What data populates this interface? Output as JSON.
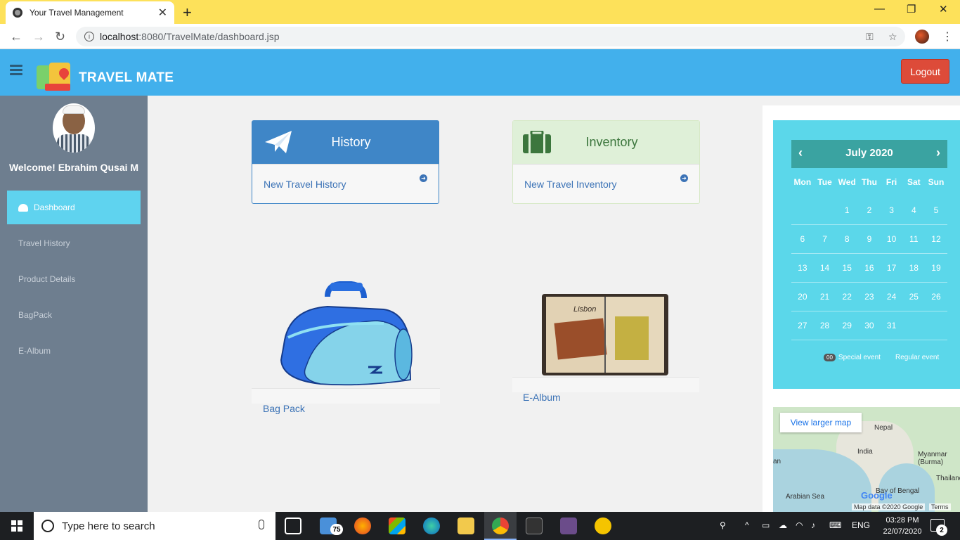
{
  "browser": {
    "tab_title": "Your Travel Management",
    "tab_close": "✕",
    "new_tab": "+",
    "url_host": "localhost",
    "url_path": ":8080/TravelMate/dashboard.jsp"
  },
  "header": {
    "brand": "TRAVEL MATE",
    "logout_label": "Logout"
  },
  "sidebar": {
    "welcome": "Welcome! Ebrahim Qusai M",
    "items": [
      {
        "label": "Dashboard",
        "active": true
      },
      {
        "label": "Travel History",
        "active": false
      },
      {
        "label": "Product Details",
        "active": false
      },
      {
        "label": "BagPack",
        "active": false
      },
      {
        "label": "E-Album",
        "active": false
      }
    ]
  },
  "cards": {
    "history": {
      "title": "History",
      "link": "New Travel History"
    },
    "inventory": {
      "title": "Inventory",
      "link": "New Travel Inventory"
    }
  },
  "gallery": {
    "bagpack_caption": "Bag Pack",
    "album_caption": "E-Album",
    "album_text": "Lisbon"
  },
  "calendar": {
    "month": "July 2020",
    "prev": "‹",
    "next": "›",
    "weekdays": [
      "Mon",
      "Tue",
      "Wed",
      "Thu",
      "Fri",
      "Sat",
      "Sun"
    ],
    "weeks": [
      [
        "",
        "",
        "1",
        "2",
        "3",
        "4",
        "5"
      ],
      [
        "6",
        "7",
        "8",
        "9",
        "10",
        "11",
        "12"
      ],
      [
        "13",
        "14",
        "15",
        "16",
        "17",
        "18",
        "19"
      ],
      [
        "20",
        "21",
        "22",
        "23",
        "24",
        "25",
        "26"
      ],
      [
        "27",
        "28",
        "29",
        "30",
        "31",
        "",
        ""
      ]
    ],
    "special_badge": "00",
    "special_label": "Special event",
    "regular_label": "Regular event"
  },
  "map": {
    "view_larger": "View larger map",
    "labels": [
      "Nepal",
      "India",
      "Myanmar (Burma)",
      "Thailand",
      "Arabian Sea",
      "Bay of Bengal",
      "an"
    ],
    "google": "Google",
    "data": "Map data ©2020 Google",
    "terms": "Terms"
  },
  "taskbar": {
    "search_placeholder": "Type here to search",
    "mail_count": "75",
    "language": "ENG",
    "time": "03:28 PM",
    "date": "22/07/2020",
    "notifications": "2"
  },
  "colors": {
    "header": "#42b0ec",
    "sidebar": "#6e7e8f",
    "active_nav": "#5fd3ef",
    "calendar": "#5bd7ea",
    "logout": "#dd4b39"
  }
}
